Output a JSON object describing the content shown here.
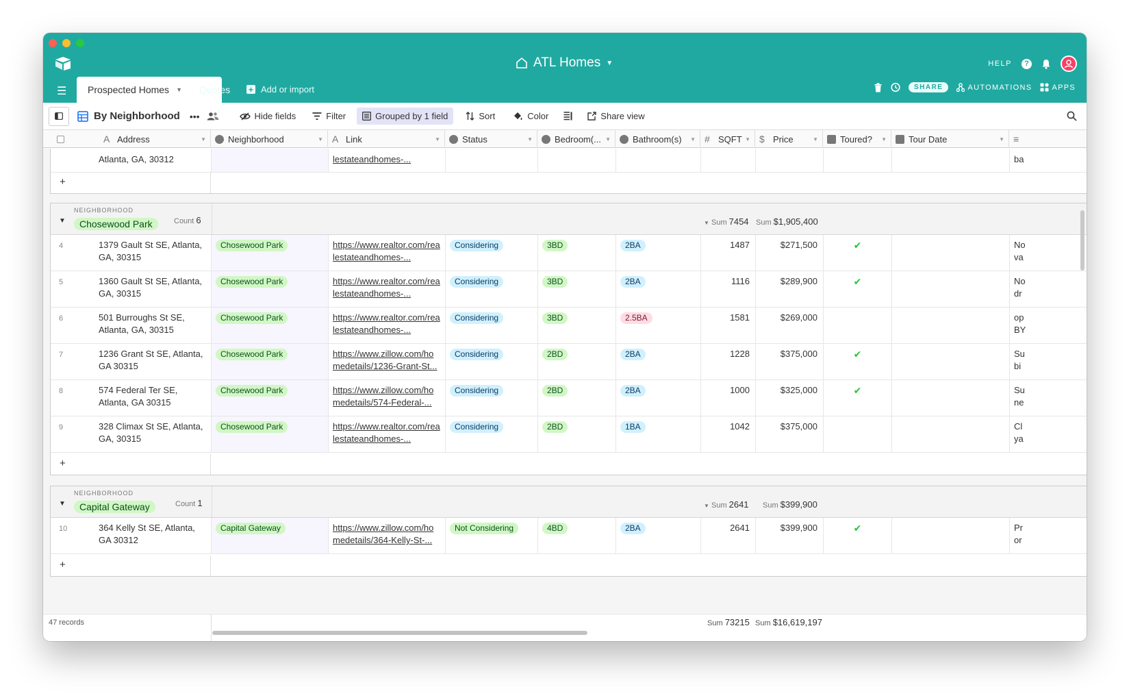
{
  "window": {
    "base_title": "ATL Homes",
    "help_label": "HELP",
    "share_label": "SHARE",
    "automations_label": "AUTOMATIONS",
    "apps_label": "APPS"
  },
  "tabs": {
    "active": "Prospected Homes",
    "second": "Quotes",
    "add_import": "Add or import"
  },
  "toolbar": {
    "view_name": "By Neighborhood",
    "hide_fields": "Hide fields",
    "filter": "Filter",
    "grouped": "Grouped by 1 field",
    "sort": "Sort",
    "color": "Color",
    "share_view": "Share view"
  },
  "columns": {
    "address": "Address",
    "neighborhood": "Neighborhood",
    "link": "Link",
    "status": "Status",
    "bedrooms": "Bedroom(...",
    "bathrooms": "Bathroom(s)",
    "sqft": "SQFT",
    "price": "Price",
    "toured": "Toured?",
    "tour_date": "Tour Date"
  },
  "partial_row": {
    "address_line2": "Atlanta, GA, 30312",
    "link_line2": "lestateandhomes-...",
    "notes": "ba"
  },
  "group_label": "NEIGHBORHOOD",
  "groups": [
    {
      "name": "Chosewood Park",
      "count_label": "Count",
      "count": "6",
      "sum_label": "Sum",
      "sqft_sum": "7454",
      "price_sum_label": "Sum",
      "price_sum": "$1,905,400",
      "rows": [
        {
          "num": "4",
          "addr1": "1379 Gault St SE, Atlanta,",
          "addr2": "GA, 30315",
          "nb": "Chosewood Park",
          "link1": "https://www.realtor.com/rea",
          "link2": "lestateandhomes-...",
          "status": "Considering",
          "bd": "3BD",
          "ba": "2BA",
          "sqft": "1487",
          "price": "$271,500",
          "toured": "✔",
          "n1": "No",
          "n2": "va"
        },
        {
          "num": "5",
          "addr1": "1360 Gault St SE, Atlanta,",
          "addr2": "GA, 30315",
          "nb": "Chosewood Park",
          "link1": "https://www.realtor.com/rea",
          "link2": "lestateandhomes-...",
          "status": "Considering",
          "bd": "3BD",
          "ba": "2BA",
          "sqft": "1116",
          "price": "$289,900",
          "toured": "✔",
          "n1": "No",
          "n2": "dr"
        },
        {
          "num": "6",
          "addr1": "501 Burroughs St SE,",
          "addr2": "Atlanta, GA, 30315",
          "nb": "Chosewood Park",
          "link1": "https://www.realtor.com/rea",
          "link2": "lestateandhomes-...",
          "status": "Considering",
          "bd": "3BD",
          "ba": "2.5BA",
          "sqft": "1581",
          "price": "$269,000",
          "toured": "",
          "n1": "op",
          "n2": "BY"
        },
        {
          "num": "7",
          "addr1": "1236 Grant St SE, Atlanta,",
          "addr2": "GA 30315",
          "nb": "Chosewood Park",
          "link1": "https://www.zillow.com/ho",
          "link2": "medetails/1236-Grant-St...",
          "status": "Considering",
          "bd": "2BD",
          "ba": "2BA",
          "sqft": "1228",
          "price": "$375,000",
          "toured": "✔",
          "n1": "Su",
          "n2": "bi"
        },
        {
          "num": "8",
          "addr1": "574 Federal Ter SE,",
          "addr2": "Atlanta, GA 30315",
          "nb": "Chosewood Park",
          "link1": "https://www.zillow.com/ho",
          "link2": "medetails/574-Federal-...",
          "status": "Considering",
          "bd": "2BD",
          "ba": "2BA",
          "sqft": "1000",
          "price": "$325,000",
          "toured": "✔",
          "n1": "Su",
          "n2": "ne"
        },
        {
          "num": "9",
          "addr1": "328 Climax St SE, Atlanta,",
          "addr2": "GA, 30315",
          "nb": "Chosewood Park",
          "link1": "https://www.realtor.com/rea",
          "link2": "lestateandhomes-...",
          "status": "Considering",
          "bd": "2BD",
          "ba": "1BA",
          "sqft": "1042",
          "price": "$375,000",
          "toured": "",
          "n1": "Cl",
          "n2": "ya"
        }
      ]
    },
    {
      "name": "Capital Gateway",
      "count_label": "Count",
      "count": "1",
      "sum_label": "Sum",
      "sqft_sum": "2641",
      "price_sum_label": "Sum",
      "price_sum": "$399,900",
      "rows": [
        {
          "num": "10",
          "addr1": "364 Kelly St SE, Atlanta,",
          "addr2": "GA 30312",
          "nb": "Capital Gateway",
          "link1": "https://www.zillow.com/ho",
          "link2": "medetails/364-Kelly-St-...",
          "status": "Not Considering",
          "bd": "4BD",
          "ba": "2BA",
          "sqft": "2641",
          "price": "$399,900",
          "toured": "✔",
          "n1": "Pr",
          "n2": "or"
        }
      ]
    }
  ],
  "footer": {
    "records": "47 records",
    "sqft_sum_label": "Sum",
    "sqft_sum": "73215",
    "price_sum_label": "Sum",
    "price_sum": "$16,619,197"
  },
  "colors": {
    "brand": "#20a9a1",
    "pill_green": "#d1f7c4",
    "pill_blue": "#d0f0fd",
    "pill_pink": "#ffdce5",
    "check": "#20c933"
  }
}
